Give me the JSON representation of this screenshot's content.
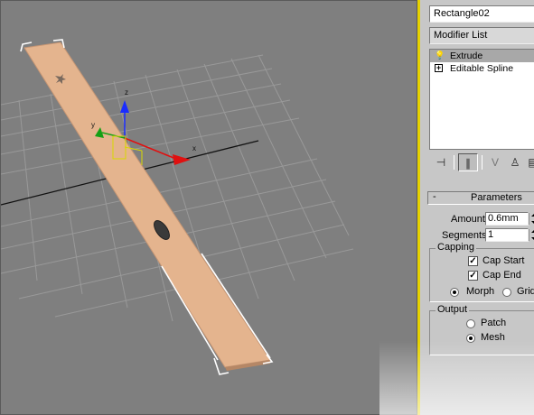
{
  "viewport": {
    "axis_labels": {
      "x": "x",
      "y": "y",
      "z": "z"
    }
  },
  "command_panel": {
    "object_name": "Rectangle02",
    "modifier_list": "Modifier List",
    "stack": [
      {
        "label": "Extrude",
        "icon": "lightbulb-icon",
        "selected": true
      },
      {
        "label": "Editable Spline",
        "icon": "plus-expand-icon",
        "selected": false
      }
    ],
    "toolbar": [
      {
        "icon": "pin-stack-icon",
        "glyph": "⊣"
      },
      {
        "icon": "show-end-result-icon",
        "glyph": "∥",
        "pressed": true
      },
      {
        "icon": "make-unique-icon",
        "glyph": "V"
      },
      {
        "icon": "remove-modifier-icon",
        "glyph": "♙"
      },
      {
        "icon": "configure-sets-icon",
        "glyph": "▤"
      }
    ],
    "parameters": {
      "rollout_title": "Parameters",
      "rollout_toggle": "-",
      "amount_label": "Amount:",
      "amount_value": "0.6mm",
      "segments_label": "Segments:",
      "segments_value": "1",
      "capping_title": "Capping",
      "cap_start_label": "Cap Start",
      "cap_start_checked": true,
      "cap_end_label": "Cap End",
      "cap_end_checked": true,
      "morph_label": "Morph",
      "grid_label": "Grid",
      "capping_mode": "Morph",
      "output_title": "Output",
      "patch_label": "Patch",
      "mesh_label": "Mesh",
      "output_mode": "Mesh"
    }
  }
}
